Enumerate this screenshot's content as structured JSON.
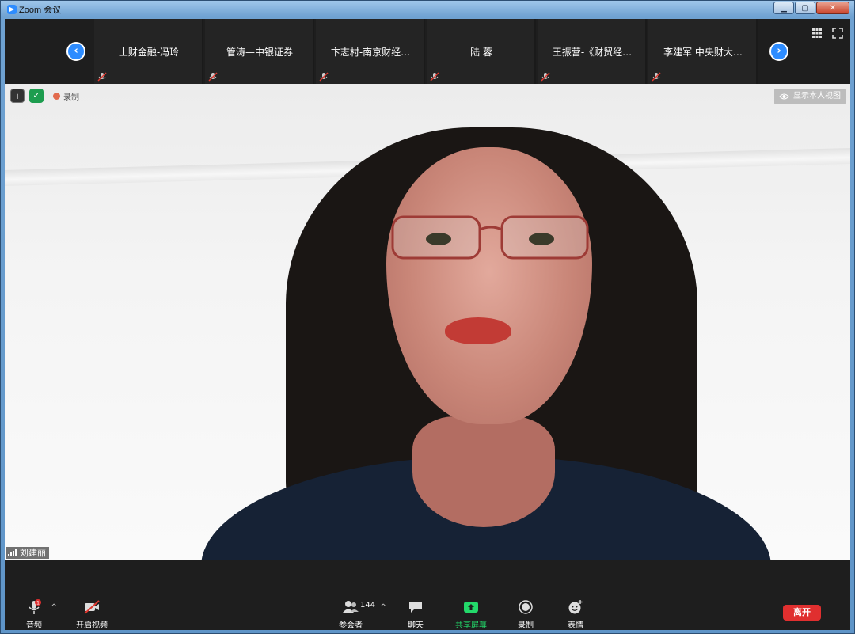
{
  "window": {
    "title": "Zoom 会议",
    "min_label": "▁",
    "max_label": "▢",
    "close_label": "✕"
  },
  "strip": {
    "participants": [
      {
        "name": "上财金融-冯玲"
      },
      {
        "name": "管涛—中银证券"
      },
      {
        "name": "卞志村-南京财经…"
      },
      {
        "name": "陆 蓉"
      },
      {
        "name": "王振营-《财贸经…"
      },
      {
        "name": "李建军 中央财大…"
      }
    ],
    "prev_icon": "chevron-left-icon",
    "next_icon": "chevron-right-icon"
  },
  "video": {
    "recording_label": "录制",
    "self_view_label": "显示本人视图",
    "speaker_name": "刘建丽"
  },
  "toolbar": {
    "audio_label": "音频",
    "audio_badge": "1",
    "video_label": "开启视频",
    "participants_label": "参会者",
    "participants_count": "144",
    "chat_label": "聊天",
    "share_label": "共享屏幕",
    "record_label": "录制",
    "reactions_label": "表情",
    "leave_label": "离开"
  },
  "colors": {
    "accent": "#2d8cff",
    "share_green": "#23d96a",
    "leave_red": "#e02f2f"
  }
}
